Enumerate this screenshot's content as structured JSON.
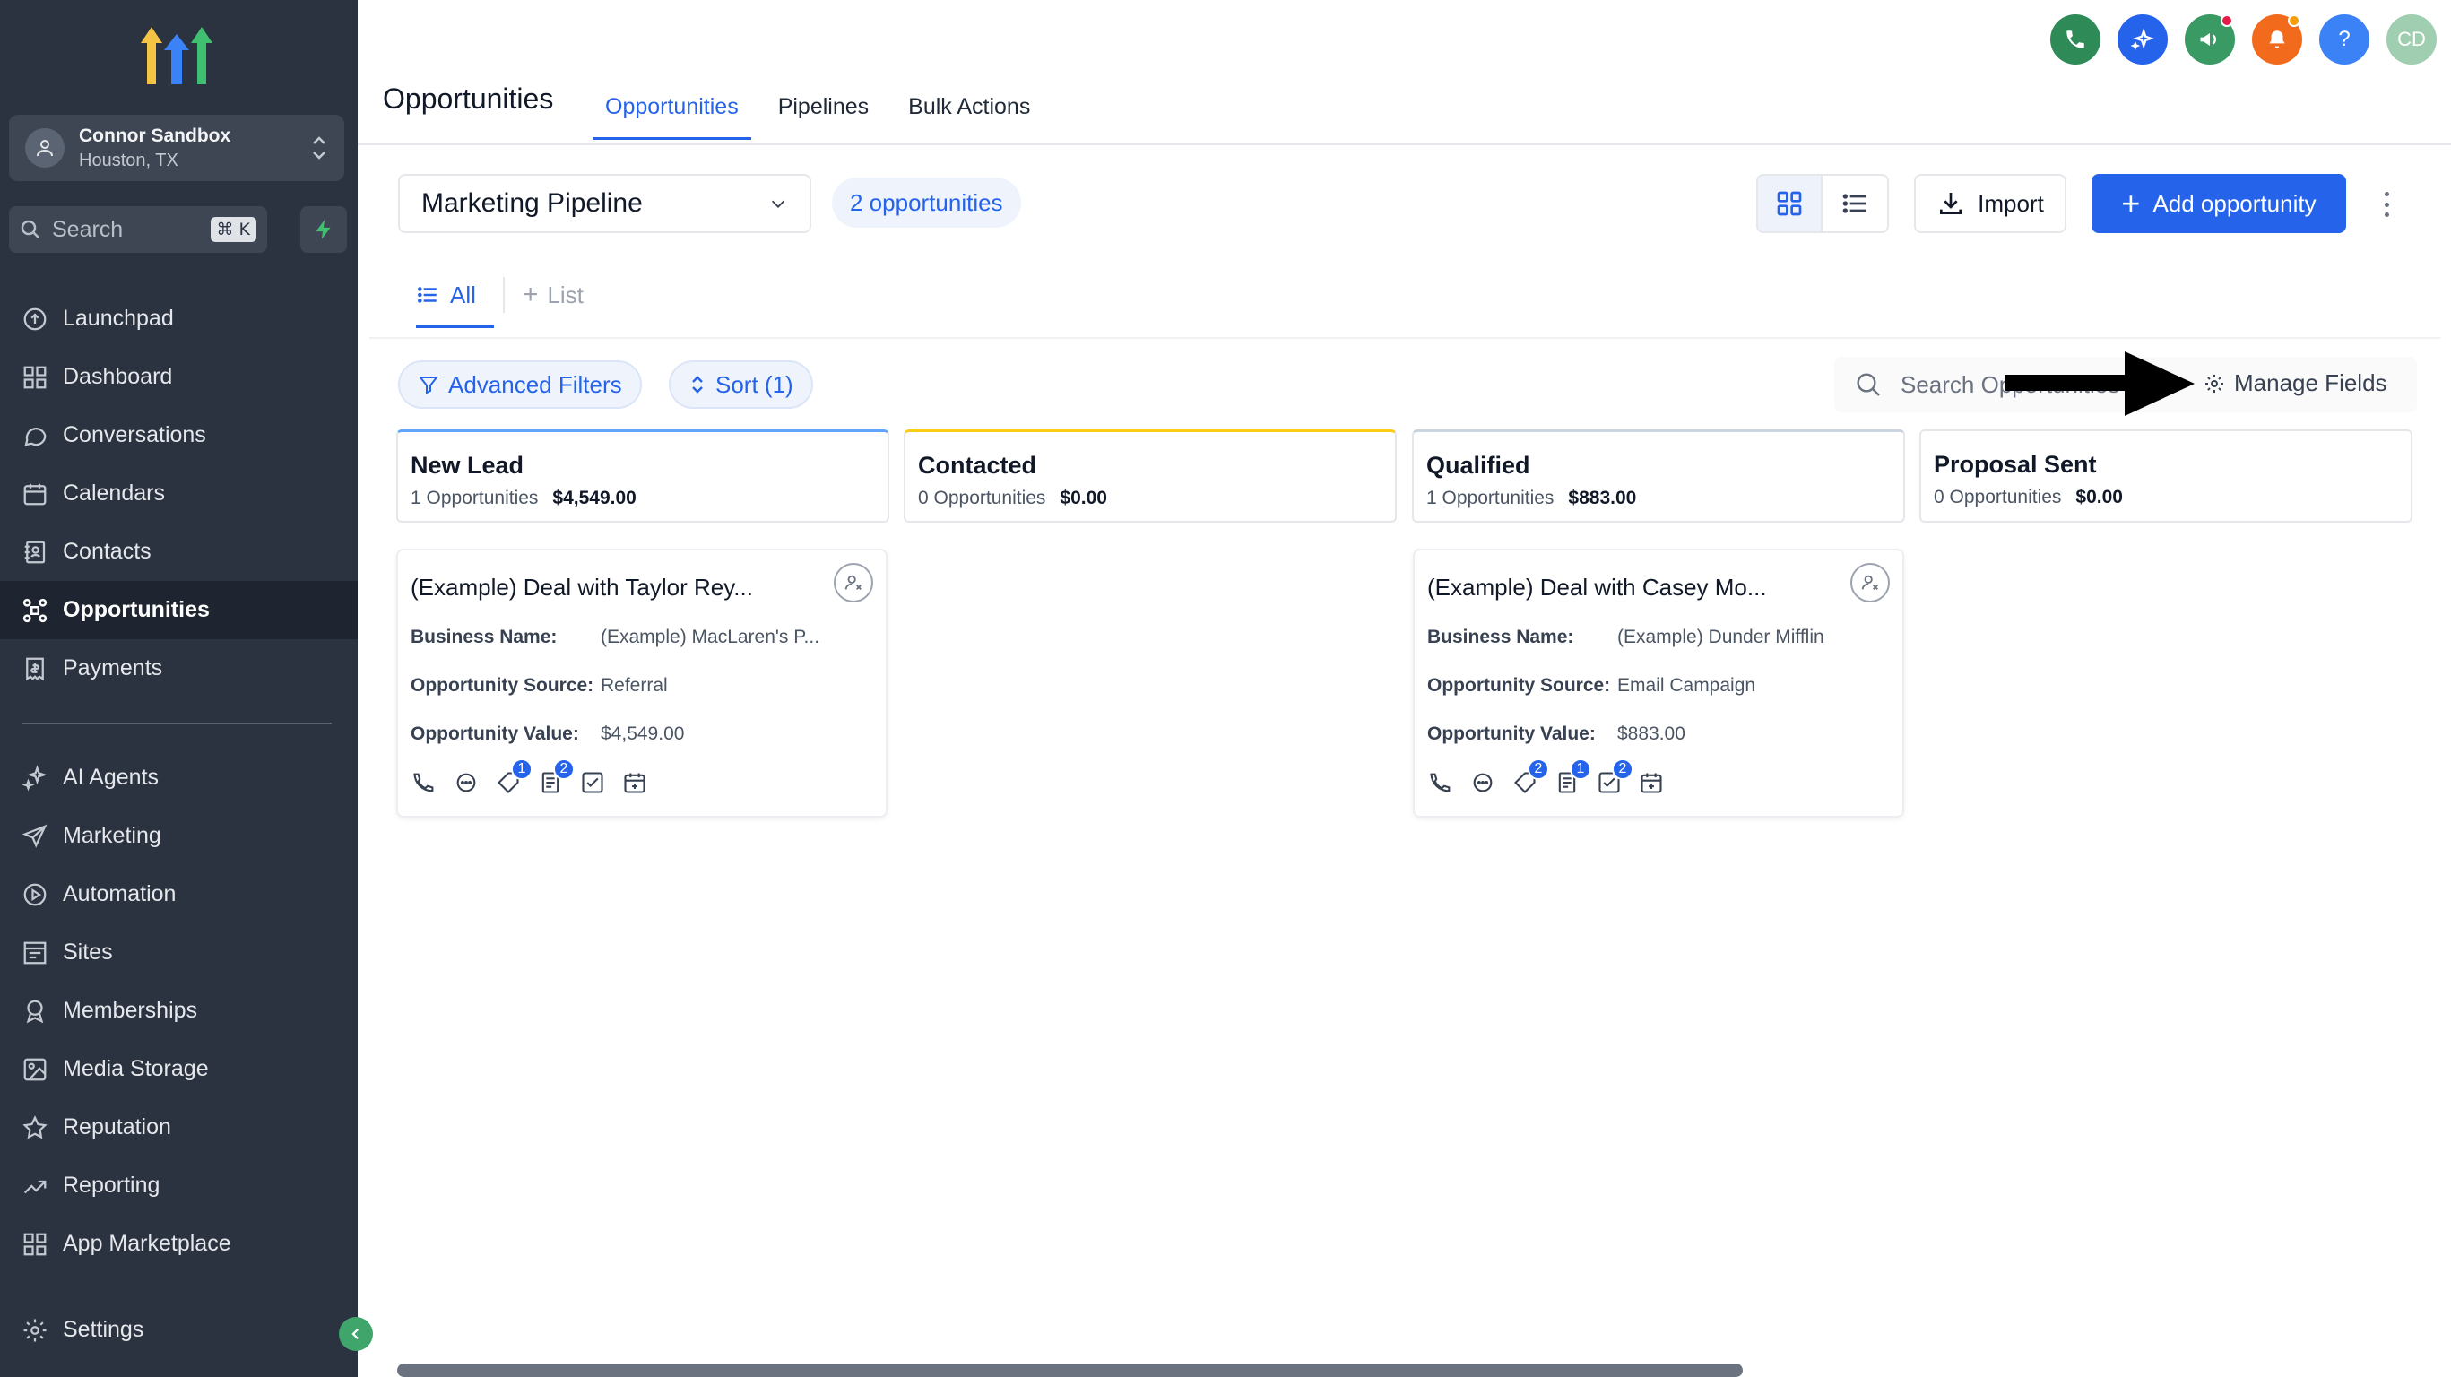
{
  "sidebar": {
    "account": {
      "name": "Connor Sandbox",
      "location": "Houston, TX"
    },
    "search": {
      "label": "Search",
      "shortcut": "⌘ K"
    },
    "items": [
      {
        "label": "Launchpad",
        "icon": "launchpad-icon"
      },
      {
        "label": "Dashboard",
        "icon": "dashboard-icon"
      },
      {
        "label": "Conversations",
        "icon": "chat-icon"
      },
      {
        "label": "Calendars",
        "icon": "calendar-icon"
      },
      {
        "label": "Contacts",
        "icon": "contacts-icon"
      },
      {
        "label": "Opportunities",
        "icon": "opportunities-icon",
        "active": true
      },
      {
        "label": "Payments",
        "icon": "payments-icon"
      }
    ],
    "items2": [
      {
        "label": "AI Agents",
        "icon": "sparkle-icon"
      },
      {
        "label": "Marketing",
        "icon": "send-icon"
      },
      {
        "label": "Automation",
        "icon": "automation-icon"
      },
      {
        "label": "Sites",
        "icon": "sites-icon"
      },
      {
        "label": "Memberships",
        "icon": "award-icon"
      },
      {
        "label": "Media Storage",
        "icon": "image-icon"
      },
      {
        "label": "Reputation",
        "icon": "star-icon"
      },
      {
        "label": "Reporting",
        "icon": "trend-icon"
      },
      {
        "label": "App Marketplace",
        "icon": "grid-icon"
      }
    ],
    "settings": {
      "label": "Settings",
      "icon": "gear-icon"
    }
  },
  "header": {
    "title": "Opportunities",
    "tabs": [
      {
        "label": "Opportunities",
        "active": true
      },
      {
        "label": "Pipelines"
      },
      {
        "label": "Bulk Actions"
      }
    ],
    "icons": [
      {
        "name": "phone-icon",
        "color": "#2e8b57"
      },
      {
        "name": "ai-sparkle-icon",
        "color": "#2563eb"
      },
      {
        "name": "megaphone-icon",
        "color": "#3a9a63"
      },
      {
        "name": "bell-icon",
        "color": "#f26b1d"
      },
      {
        "name": "help-icon",
        "color": "#3b82f6",
        "label": "?"
      },
      {
        "name": "avatar",
        "color": "#9fcfb0",
        "label": "CD"
      }
    ]
  },
  "toolbar": {
    "pipeline": "Marketing Pipeline",
    "count": "2 opportunities",
    "import": "Import",
    "add": "Add opportunity"
  },
  "subtabs": {
    "all": "All",
    "add_list": "List"
  },
  "filters": {
    "advanced": "Advanced Filters",
    "sort": "Sort (1)",
    "search_placeholder": "Search Opportunities",
    "manage_fields": "Manage Fields"
  },
  "columns": [
    {
      "title": "New Lead",
      "count": "1 Opportunities",
      "total": "$4,549.00",
      "accent": "#60a5fa"
    },
    {
      "title": "Contacted",
      "count": "0 Opportunities",
      "total": "$0.00",
      "accent": "#facc15"
    },
    {
      "title": "Qualified",
      "count": "1 Opportunities",
      "total": "$883.00",
      "accent": "#cbd5e1"
    },
    {
      "title": "Proposal Sent",
      "count": "0 Opportunities",
      "total": "$0.00",
      "accent": "#e5e7eb"
    }
  ],
  "cards": [
    {
      "title": "(Example) Deal with Taylor Rey...",
      "fields": [
        {
          "k": "Business Name:",
          "v": "(Example) MacLaren's P..."
        },
        {
          "k": "Opportunity Source:",
          "v": "Referral"
        },
        {
          "k": "Opportunity Value:",
          "v": "$4,549.00"
        }
      ],
      "badges": {
        "tag": "1",
        "notes": "2"
      }
    },
    {
      "title": "(Example) Deal with Casey Mo...",
      "fields": [
        {
          "k": "Business Name:",
          "v": "(Example) Dunder Mifflin"
        },
        {
          "k": "Opportunity Source:",
          "v": "Email Campaign"
        },
        {
          "k": "Opportunity Value:",
          "v": "$883.00"
        }
      ],
      "badges": {
        "tag": "2",
        "notes": "1",
        "tasks": "2"
      }
    }
  ]
}
